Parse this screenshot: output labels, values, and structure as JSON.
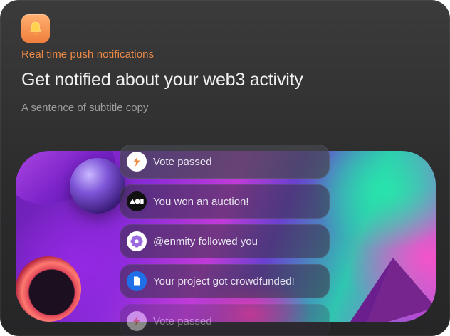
{
  "header": {
    "app_icon": "bell-icon",
    "eyebrow": "Real time push notifications",
    "title": "Get notified about your web3 activity",
    "subtitle": "A sentence of subtitle copy"
  },
  "notifications": [
    {
      "text": "Vote passed",
      "icon": "lightning-icon",
      "icon_bg": "#ffffff",
      "icon_color": "#f08a3c"
    },
    {
      "text": "You won an auction!",
      "icon": "shapes-logo-icon",
      "icon_bg": "#111111",
      "icon_color": "#ffffff"
    },
    {
      "text": "@enmity followed you",
      "icon": "flower-icon",
      "icon_bg": "#ffffff",
      "icon_color": "#9b6bdf"
    },
    {
      "text": "Your project got crowdfunded!",
      "icon": "tag-icon",
      "icon_bg": "#1f6fe8",
      "icon_color": "#ffffff"
    },
    {
      "text": "Vote passed",
      "icon": "lightning-icon",
      "icon_bg": "#ffffff",
      "icon_color": "#f08a3c"
    }
  ],
  "colors": {
    "accent": "#ee8a45",
    "title": "#f1f1f1",
    "subtitle": "#9c9c9e",
    "card_bg": "#2e2e2f"
  }
}
